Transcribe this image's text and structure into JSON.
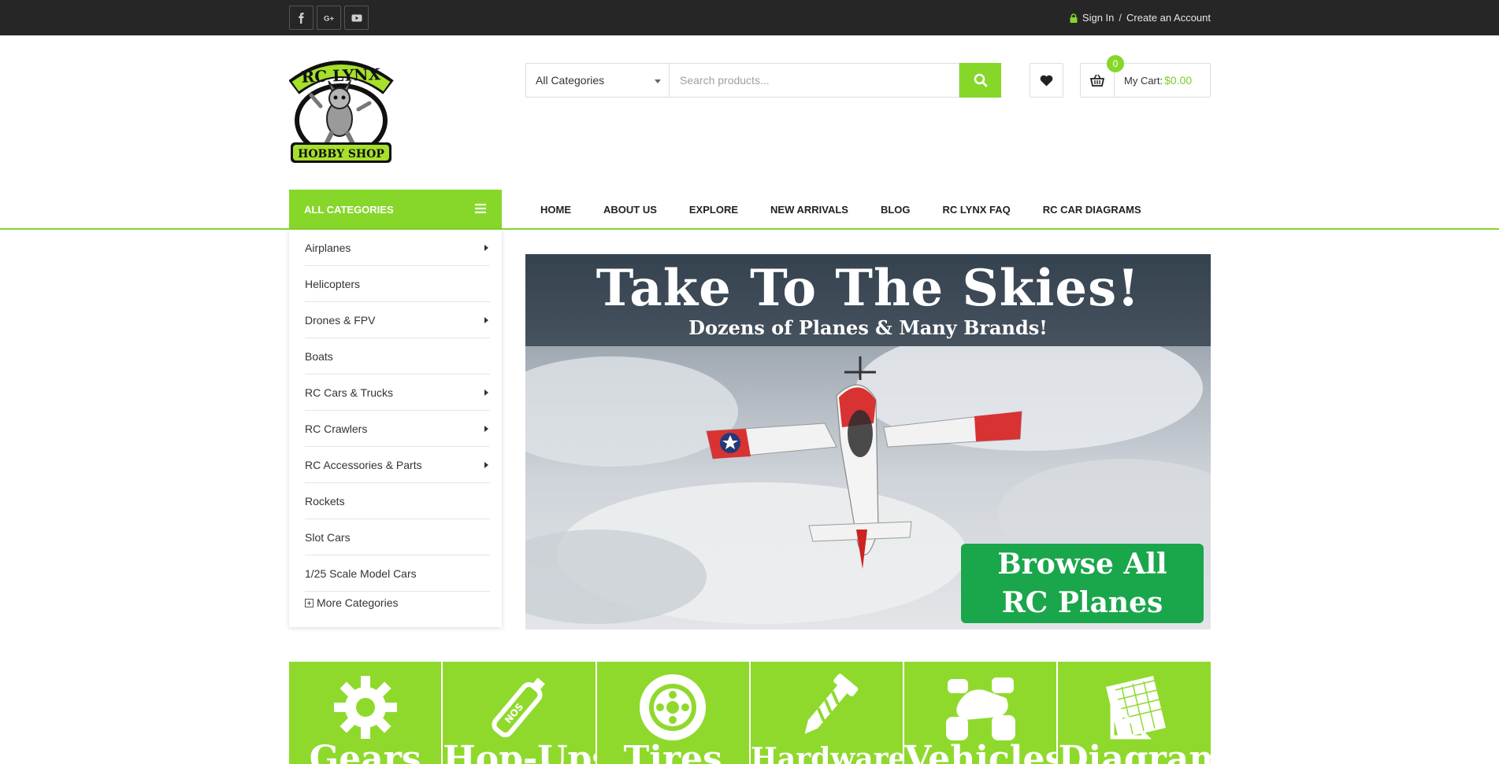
{
  "topbar": {
    "social": [
      "facebook-icon",
      "google-plus-icon",
      "youtube-icon"
    ],
    "sign_in": "Sign In",
    "separator": "/",
    "create_account": "Create an Account"
  },
  "header": {
    "logo_text": [
      "RC LYNX",
      "HOBBY SHOP"
    ],
    "category_select": "All Categories",
    "search_placeholder": "Search products...",
    "cart_count": "0",
    "cart_label": "My Cart:",
    "cart_amount": "$0.00"
  },
  "nav": {
    "all_categories": "ALL CATEGORIES",
    "items": [
      "HOME",
      "ABOUT US",
      "EXPLORE",
      "NEW ARRIVALS",
      "BLOG",
      "RC LYNX FAQ",
      "RC CAR DIAGRAMS"
    ]
  },
  "categories": {
    "items": [
      {
        "label": "Airplanes",
        "has_sub": true
      },
      {
        "label": "Helicopters",
        "has_sub": false
      },
      {
        "label": "Drones & FPV",
        "has_sub": true
      },
      {
        "label": "Boats",
        "has_sub": false
      },
      {
        "label": "RC Cars & Trucks",
        "has_sub": true
      },
      {
        "label": "RC Crawlers",
        "has_sub": true
      },
      {
        "label": "RC Accessories & Parts",
        "has_sub": true
      },
      {
        "label": "Rockets",
        "has_sub": false
      },
      {
        "label": "Slot Cars",
        "has_sub": false
      },
      {
        "label": "1/25 Scale Model Cars",
        "has_sub": false
      }
    ],
    "more": "More Categories"
  },
  "hero": {
    "title": "Take To The Skies!",
    "subtitle": "Dozens of Planes & Many Brands!",
    "cta_line1": "Browse All",
    "cta_line2": "RC Planes"
  },
  "tiles": [
    {
      "label": "Gears",
      "icon": "gear-icon"
    },
    {
      "label": "Hop-Ups",
      "icon": "nos-bottle-icon"
    },
    {
      "label": "Tires",
      "icon": "tire-icon"
    },
    {
      "label": "Hardware",
      "icon": "screw-icon"
    },
    {
      "label": "Vehicles",
      "icon": "buggy-icon"
    },
    {
      "label": "Diagrams",
      "icon": "blueprint-icon"
    }
  ],
  "colors": {
    "accent": "#86d72a",
    "topbar": "#262626",
    "cta_green": "#1aa64b",
    "hero_header": "#3a4653"
  }
}
